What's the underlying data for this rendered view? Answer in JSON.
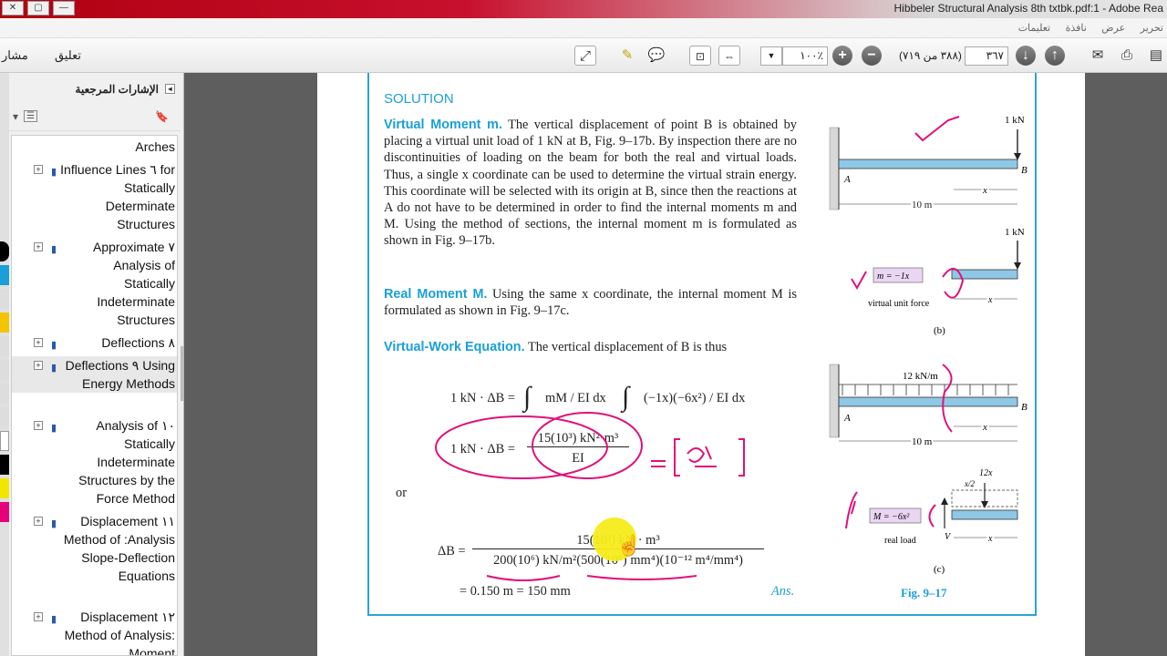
{
  "window": {
    "title": "Hibbeler Structural Analysis 8th txtbk.pdf:1 - Adobe Rea"
  },
  "menu": [
    "تحرير",
    "عرض",
    "نافذة",
    "تعليمات"
  ],
  "toolbar": {
    "comment_label": "تعليق",
    "share_label": "مشار",
    "zoom_value": "١٠٠٪",
    "page_total": "(٣٨٨ من ٧١٩)",
    "page_current": "٣٦٧"
  },
  "sidebar": {
    "title": "الإشارات المرجعية",
    "items": [
      {
        "label": "Arches"
      },
      {
        "label": "Influence Lines ٦ for Statically Determinate Structures"
      },
      {
        "label": "Approximate ٧ Analysis of Statically Indeterminate Structures"
      },
      {
        "label": "Deflections ٨"
      },
      {
        "label": "Deflections ٩ Using Energy Methods"
      },
      {
        "label": "Analysis of ١٠ Statically Indeterminate Structures by the Force Method"
      },
      {
        "label": "Displacement ١١ Method of :Analysis Slope-Deflection Equations"
      },
      {
        "label": "Displacement ١٢ Method of Analysis: Moment"
      }
    ]
  },
  "page": {
    "solution_heading": "SOLUTION",
    "p1_head": "Virtual Moment m.",
    "p1_body": "The vertical displacement of point B is obtained by placing a virtual unit load of 1 kN at B, Fig. 9–17b. By inspection there are no discontinuities of loading on the beam for both the real and virtual loads. Thus, a single x coordinate can be used to determine the virtual strain energy. This coordinate will be selected with its origin at B, since then the reactions at A do not have to be determined in order to find the internal moments m and M. Using the method of sections, the internal moment m is formulated as shown in Fig. 9–17b.",
    "p2_head": "Real Moment M.",
    "p2_body": "Using the same x coordinate, the internal moment M is formulated as shown in Fig. 9–17c.",
    "p3_head": "Virtual-Work Equation.",
    "p3_body": "The vertical displacement of B is thus",
    "eq1_left": "1 kN · ΔB =",
    "eq1_mid": "mM / EI dx",
    "eq1_right": "(−1x)(−6x²) / EI dx",
    "eq2_left": "1 kN · ΔB =",
    "eq2_num": "15(10³) kN²·m³",
    "eq2_den": "EI",
    "or": "or",
    "eq3_left": "ΔB =",
    "eq3_num": "15(10³) kN · m³",
    "eq3_den": "200(10⁶) kN/m²(500(10⁶) mm⁴)(10⁻¹² m⁴/mm⁴)",
    "eq4": "= 0.150 m = 150 mm",
    "ans": "Ans.",
    "fig_caption": "Fig. 9–17",
    "fig_labels": {
      "load_top": "1 kN",
      "point_a": "A",
      "point_b": "B",
      "span": "10 m",
      "x": "x",
      "load_mid": "1 kN",
      "m_label": "m = −1x",
      "virtual_unit_force": "virtual unit force",
      "b_caption": "(b)",
      "dist_load": "12 kN/m",
      "m_label_c": "M = −6x²",
      "real_load": "real load",
      "twelve_x": "12x",
      "x_half": "x/2",
      "c_caption": "(c)",
      "v_label": "V"
    },
    "tab": "9"
  }
}
